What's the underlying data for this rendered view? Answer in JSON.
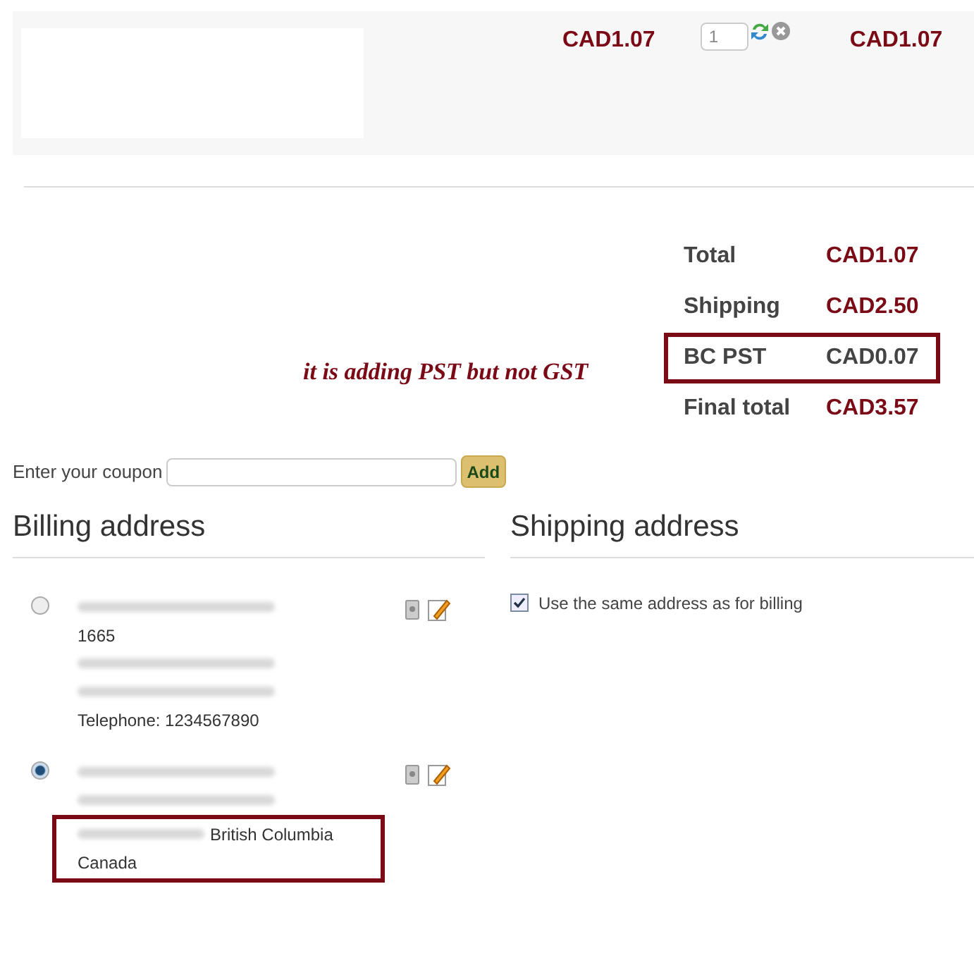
{
  "cart_item": {
    "price": "CAD1.07",
    "quantity": "1",
    "total": "CAD1.07"
  },
  "totals": [
    {
      "label": "Total",
      "value": "CAD1.07",
      "highlighted": false
    },
    {
      "label": "Shipping",
      "value": "CAD2.50",
      "highlighted": false
    },
    {
      "label": "BC PST",
      "value": "CAD0.07",
      "highlighted": true
    },
    {
      "label": "Final total",
      "value": "CAD3.57",
      "highlighted": false
    }
  ],
  "annotation": "it is adding PST but not GST",
  "coupon": {
    "label": "Enter your coupon",
    "button": "Add"
  },
  "billing": {
    "heading": "Billing address",
    "addresses": [
      {
        "selected": false,
        "lines": [
          {
            "kind": "redacted"
          },
          {
            "kind": "text",
            "text": "1665",
            "highlighted": false
          },
          {
            "kind": "redacted"
          },
          {
            "kind": "redacted"
          },
          {
            "kind": "text",
            "text": "Telephone: 1234567890",
            "highlighted": false
          }
        ]
      },
      {
        "selected": true,
        "lines": [
          {
            "kind": "redacted"
          },
          {
            "kind": "redacted"
          },
          {
            "kind": "text",
            "text": "British Columbia",
            "redacted_prefix": true,
            "highlighted": true
          },
          {
            "kind": "text",
            "text": "Canada",
            "highlighted": true
          }
        ]
      }
    ]
  },
  "shipping": {
    "heading": "Shipping address",
    "same_as_billing": {
      "label": "Use the same address as for billing",
      "checked": true
    }
  }
}
